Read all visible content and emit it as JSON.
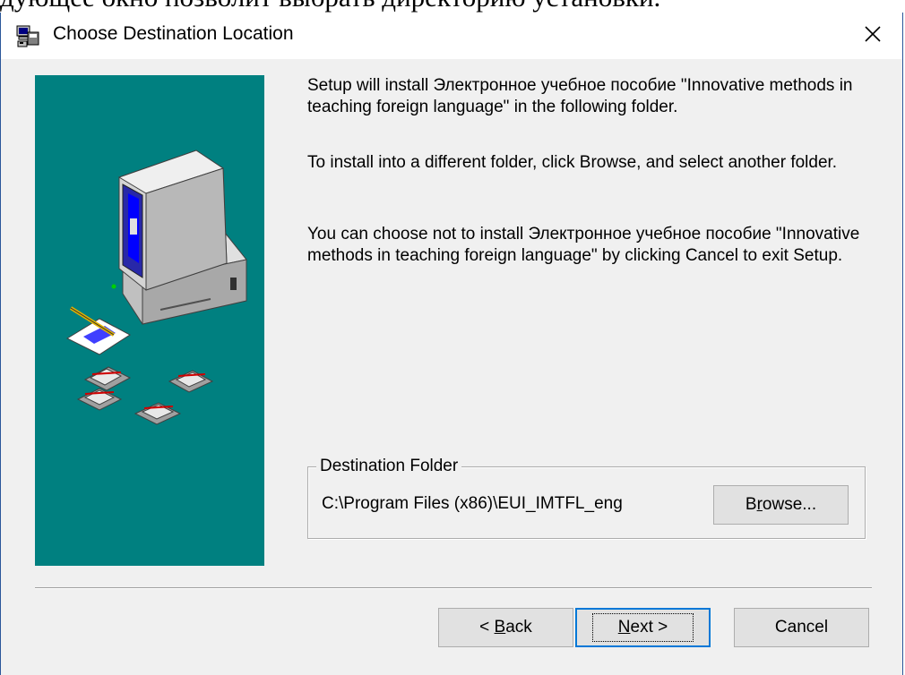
{
  "background_text": "дующее окно позволит выбрать директорию установки.",
  "window": {
    "title": "Choose Destination Location",
    "close_label": "✕"
  },
  "icons": {
    "app": "setup-installer-icon",
    "side": "computer-with-floppy-disks-illustration",
    "close": "close-icon"
  },
  "content": {
    "message1": "Setup will install Электронное учебное пособие \"Innovative methods in teaching foreign language\" in the following folder.",
    "message2": "To install into a different folder, click Browse, and select another folder.",
    "message3": "You can choose not to install Электронное учебное пособие \"Innovative methods in teaching foreign language\" by clicking Cancel to exit Setup."
  },
  "destination": {
    "group_label": "Destination Folder",
    "path": "C:\\Program Files (x86)\\EUI_IMTFL_eng",
    "browse_pre": "B",
    "browse_accel": "r",
    "browse_post": "owse..."
  },
  "buttons": {
    "back_pre": "< ",
    "back_accel": "B",
    "back_post": "ack",
    "next_accel": "N",
    "next_post": "ext >",
    "cancel": "Cancel"
  },
  "colors": {
    "side_panel": "#008080",
    "window_bg": "#f0f0f0",
    "default_button_border": "#0078d7"
  }
}
